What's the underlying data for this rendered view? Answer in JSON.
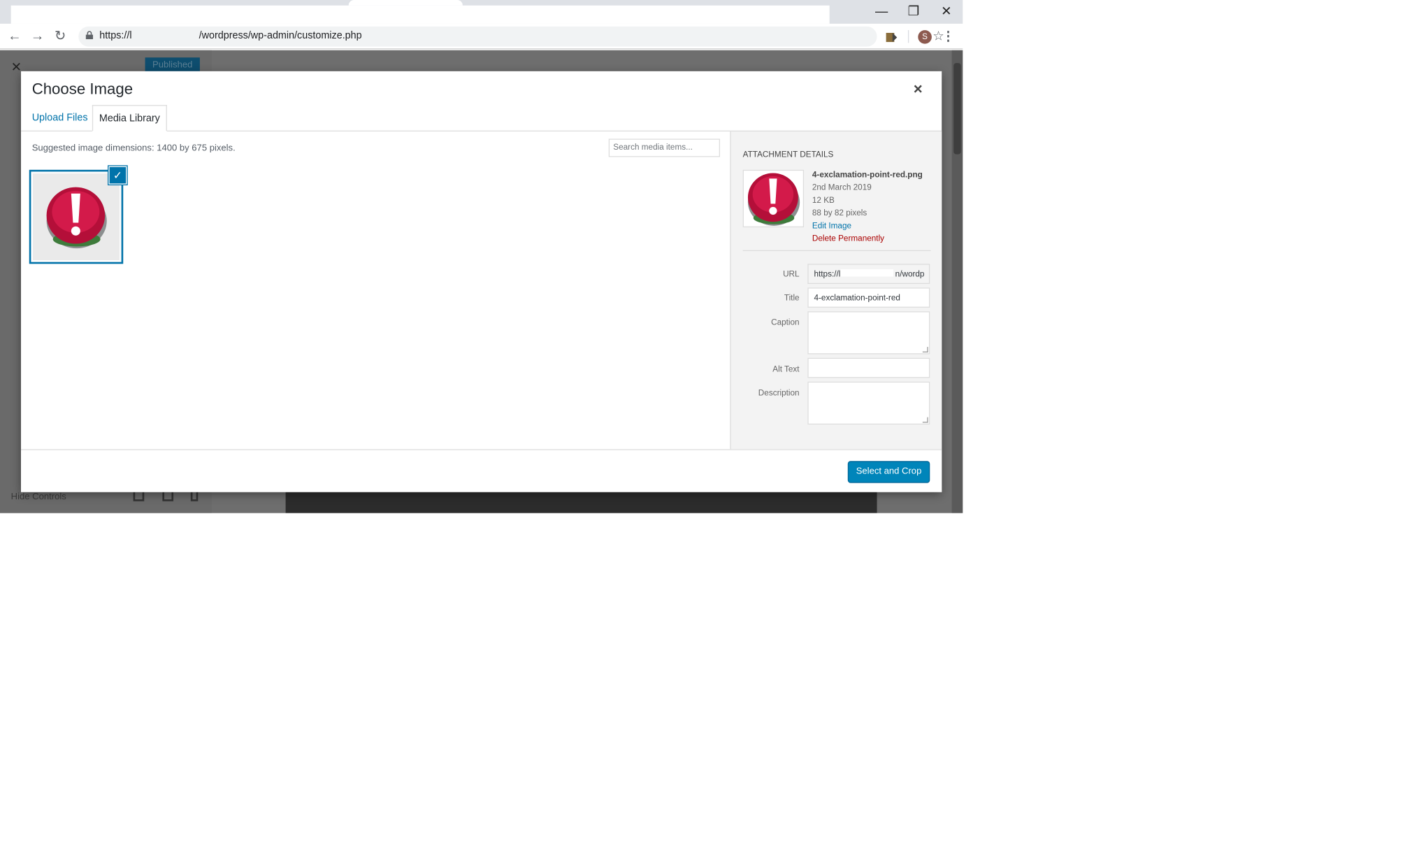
{
  "browser": {
    "url_prefix": "https://l",
    "url_suffix": "/wordpress/wp-admin/customize.php",
    "avatar_letter": "S",
    "minimize_glyph": "—",
    "restore_glyph": "❐",
    "close_glyph": "✕",
    "back_glyph": "←",
    "forward_glyph": "→",
    "reload_glyph": "↻",
    "star_glyph": "☆",
    "menu_glyph": "⋮"
  },
  "background": {
    "published_label": "Published",
    "hide_controls_label": "Hide Controls",
    "close_glyph": "✕"
  },
  "modal": {
    "title": "Choose Image",
    "close_glyph": "×",
    "tabs": [
      {
        "label": "Upload Files",
        "active": false
      },
      {
        "label": "Media Library",
        "active": true
      }
    ],
    "suggested_dimensions": "Suggested image dimensions: 1400 by 675 pixels.",
    "search_placeholder": "Search media items...",
    "check_glyph": "✓",
    "attachment": {
      "header": "Attachment Details",
      "filename": "4-exclamation-point-red.png",
      "date": "2nd March 2019",
      "size": "12 KB",
      "dimensions": "88 by 82 pixels",
      "edit_link": "Edit Image",
      "delete_link": "Delete Permanently",
      "fields": {
        "url_label": "URL",
        "url_prefix": "https://l",
        "url_suffix": "n/wordp",
        "title_label": "Title",
        "title_value": "4-exclamation-point-red",
        "caption_label": "Caption",
        "caption_value": "",
        "alt_label": "Alt Text",
        "alt_value": "",
        "description_label": "Description",
        "description_value": ""
      }
    },
    "primary_button": "Select and Crop"
  },
  "colors": {
    "wp_link": "#0073aa",
    "wp_primary": "#0085ba",
    "delete_red": "#aa0000",
    "icon_red": "#c2123f"
  },
  "icons": [
    "lock-icon",
    "extension-icon",
    "exclamation-point-icon",
    "checkmark-icon"
  ]
}
